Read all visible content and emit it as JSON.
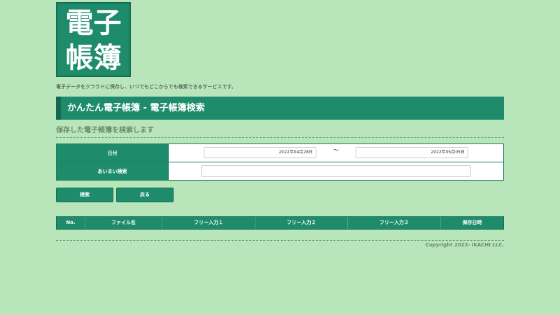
{
  "logo": {
    "line1": "電子",
    "line2": "帳簿"
  },
  "tagline": "電子データをクラウドに保存し、いつでもどこからでも検索できるサービスです。",
  "title": "かんたん電子帳簿 - 電子帳簿検索",
  "subtitle": "保存した電子帳簿を検索します",
  "form": {
    "date_label": "日付",
    "date_from": "2022年04月28日",
    "tilde": "〜",
    "date_to": "2022年05月05日",
    "fuzzy_label": "あいまい検索",
    "fuzzy_value": ""
  },
  "buttons": {
    "search": "検索",
    "back": "戻る"
  },
  "results": {
    "columns": [
      "No.",
      "ファイル名",
      "フリー入力１",
      "フリー入力２",
      "フリー入力３",
      "保存日時"
    ]
  },
  "footer": {
    "copyright": "Copyright 2022- IKACHI LLC."
  }
}
